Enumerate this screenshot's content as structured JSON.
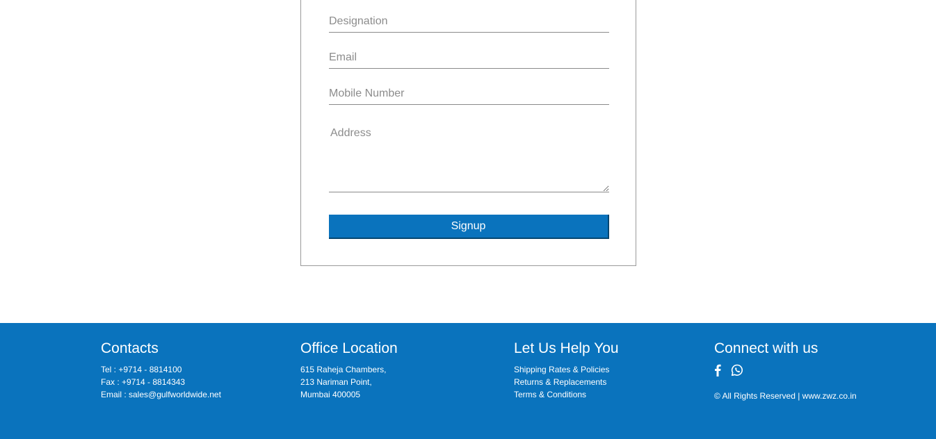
{
  "form": {
    "designation_placeholder": "Designation",
    "email_placeholder": "Email",
    "mobile_placeholder": "Mobile Number",
    "address_placeholder": "Address",
    "signup_label": "Signup"
  },
  "footer": {
    "contacts": {
      "title": "Contacts",
      "tel": "Tel : +9714 - 8814100",
      "fax": "Fax : +9714 - 8814343",
      "email": "Email : sales@gulfworldwide.net"
    },
    "office": {
      "title": "Office Location",
      "line1": "615 Raheja Chambers,",
      "line2": "213 Nariman Point,",
      "line3": "Mumbai 400005"
    },
    "help": {
      "title": "Let Us Help You",
      "links": [
        "Shipping Rates & Policies",
        "Returns & Replacements",
        "Terms & Conditions"
      ]
    },
    "connect": {
      "title": "Connect with us",
      "icons": [
        "facebook-icon",
        "whatsapp-icon"
      ],
      "copyright": "© All Rights Reserved | www.zwz.co.in"
    }
  },
  "colors": {
    "brand_blue": "#0a73bd",
    "button_shadow": "#06456f",
    "border_gray": "#9a9a9a"
  }
}
